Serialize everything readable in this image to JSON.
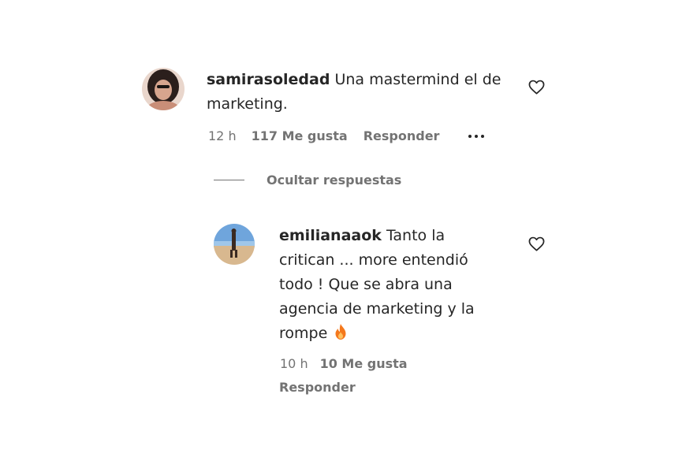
{
  "comments": [
    {
      "username": "samirasoledad",
      "text": "Una mastermind el de marketing.",
      "time": "12 h",
      "likes": "117 Me gusta",
      "reply_label": "Responder"
    }
  ],
  "hide_replies_label": "Ocultar respuestas",
  "replies": [
    {
      "username": "emilianaaok",
      "text": "Tanto la critican ... more entendió todo ! Que se abra una agencia de marketing y la rompe",
      "emoji": "fire-icon",
      "time": "10 h",
      "likes": "10 Me gusta",
      "reply_label": "Responder"
    }
  ],
  "colors": {
    "text": "#262626",
    "secondary": "#737373",
    "fire": "#f4781c"
  }
}
